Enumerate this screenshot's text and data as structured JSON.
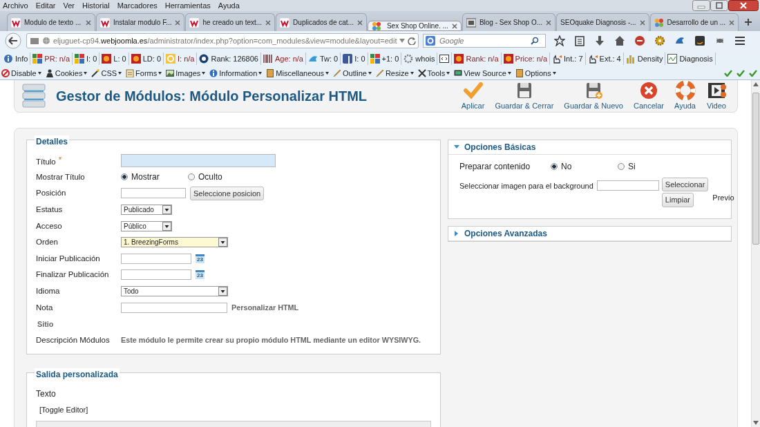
{
  "menu_bar": {
    "items": [
      "Archivo",
      "Editar",
      "Ver",
      "Historial",
      "Marcadores",
      "Herramientas",
      "Ayuda"
    ]
  },
  "tabs": [
    {
      "label": "Modulo de texto ...",
      "kind": "w",
      "selected": false
    },
    {
      "label": "Instalar modulo F...",
      "kind": "w",
      "selected": false
    },
    {
      "label": "he creado un text...",
      "kind": "w",
      "selected": false
    },
    {
      "label": "Duplicados de cat...",
      "kind": "w",
      "selected": false
    },
    {
      "label": "Sex Shop Online. ...",
      "kind": "joomla",
      "selected": true
    },
    {
      "label": "Blog - Sex Shop O...",
      "kind": "blog",
      "selected": false
    },
    {
      "label": "SEOquake Diagnosis -...",
      "kind": "plain",
      "selected": false
    },
    {
      "label": "Desarrollo de un ...",
      "kind": "joomla",
      "selected": false
    }
  ],
  "address_bar": {
    "url": "eljuguet-cp94.**webjoomla.es**/administrator/index.php?option=com_modules&view=module&layout=edit",
    "search_placeholder": "Google"
  },
  "seo_bar": [
    {
      "kind": "info",
      "label": "Info",
      "warning": false
    },
    {
      "kind": "squares",
      "label": "PR: n/a",
      "warning": true
    },
    {
      "kind": "squares",
      "label": "I: 0",
      "warning": false
    },
    {
      "kind": "flame",
      "label": "L: 0",
      "warning": false
    },
    {
      "kind": "flame",
      "label": "LD: 0",
      "warning": false
    },
    {
      "kind": "ring",
      "label": "I: n/a",
      "warning": true
    },
    {
      "kind": "circle",
      "label": "Rank: 126806",
      "warning": false
    },
    {
      "kind": "barcode",
      "label": "Age: n/a",
      "warning": true
    },
    {
      "kind": "bird",
      "label": "Tw: 0",
      "warning": false
    },
    {
      "kind": "square",
      "label": "I: 0",
      "warning": false
    },
    {
      "kind": "squares",
      "label": "+1: 0",
      "warning": false
    },
    {
      "kind": "gear",
      "label": "whois",
      "warning": false
    },
    {
      "kind": "code"
    },
    {
      "kind": "flame",
      "label": "Rank: n/a",
      "warning": true
    },
    {
      "kind": "flame",
      "label": "Price: n/a",
      "warning": true
    },
    {
      "kind": "hand",
      "label": "Int.: 7",
      "warning": false
    },
    {
      "kind": "hand",
      "label": "Ext.: 4",
      "warning": false
    },
    {
      "kind": "bars",
      "label": "Density",
      "warning": false
    },
    {
      "kind": "chart",
      "label": "Diagnosis",
      "warning": false
    }
  ],
  "dev_toolbar": [
    {
      "kind": "disable",
      "label": "Disable"
    },
    {
      "kind": "figure",
      "label": "Cookies"
    },
    {
      "kind": "wand",
      "label": "CSS"
    },
    {
      "kind": "clipboard",
      "label": "Forms"
    },
    {
      "kind": "picture",
      "label": "Images"
    },
    {
      "kind": "info",
      "label": "Information"
    },
    {
      "kind": "box",
      "label": "Miscellaneous"
    },
    {
      "kind": "pencil",
      "label": "Outline"
    },
    {
      "kind": "pencil",
      "label": "Resize"
    },
    {
      "kind": "tools",
      "label": "Tools"
    },
    {
      "kind": "monitor",
      "label": "View Source"
    },
    {
      "kind": "box",
      "label": "Options"
    }
  ],
  "page_title": "Gestor de Módulos: Módulo Personalizar HTML",
  "toolbar": [
    {
      "kind": "check",
      "label": "Aplicar"
    },
    {
      "kind": "floppy",
      "label": "Guardar & Cerrar"
    },
    {
      "kind": "floppy-plus",
      "label": "Guardar & Nuevo"
    },
    {
      "kind": "cancel",
      "label": "Cancelar"
    },
    {
      "kind": "lifebuoy",
      "label": "Ayuda"
    },
    {
      "kind": "film",
      "label": "Video"
    }
  ],
  "details": {
    "legend": "Detalles",
    "fields": [
      {
        "kind": "text",
        "label": "Título",
        "marker": "*",
        "color": "#d6e9f8"
      },
      {
        "kind": "radio",
        "label": "Mostrar Título",
        "options": [
          {
            "label": "Mostrar",
            "selected": true
          },
          {
            "label": "Oculto",
            "selected": false
          }
        ]
      },
      {
        "kind": "text-button",
        "label": "Posición",
        "button": "Seleccione posicion"
      },
      {
        "kind": "short-select",
        "label": "Estatus",
        "value": "Publicado"
      },
      {
        "kind": "short-select",
        "label": "Acceso",
        "value": "Público"
      },
      {
        "kind": "select",
        "label": "Orden",
        "value": "1. BreezingForms",
        "color": "#fdf9d2"
      },
      {
        "kind": "date",
        "label": "Iniciar Publicación",
        "calendar_day": "23"
      },
      {
        "kind": "date",
        "label": "Finalizar Publicación",
        "calendar_day": "23"
      },
      {
        "kind": "select",
        "label": "Idioma",
        "value": "Todo"
      },
      {
        "kind": "text-note",
        "label": "Nota",
        "note": "Personalizar HTML"
      },
      {
        "kind": "section",
        "label": "Sitio"
      },
      {
        "kind": "info",
        "label": "Descripción Módulos",
        "text": "Este módulo le permite crear su propio módulo HTML mediante un editor WYSIWYG."
      }
    ]
  },
  "basic_options": {
    "title": "Opciones Básicas",
    "expanded": true,
    "prepare": {
      "label": "Preparar contenido",
      "options": [
        {
          "label": "No",
          "selected": true
        },
        {
          "label": "Si",
          "selected": false
        }
      ]
    },
    "image": {
      "label": "Seleccionar imagen para el background",
      "select_button": "Seleccionar",
      "clear_button": "Limpiar",
      "preview": "Previo"
    }
  },
  "advanced_options": {
    "title": "Opciones Avanzadas",
    "expanded": false
  },
  "custom_output": {
    "legend": "Salida personalizada",
    "label": "Texto",
    "toggle": "[Toggle Editor]"
  }
}
